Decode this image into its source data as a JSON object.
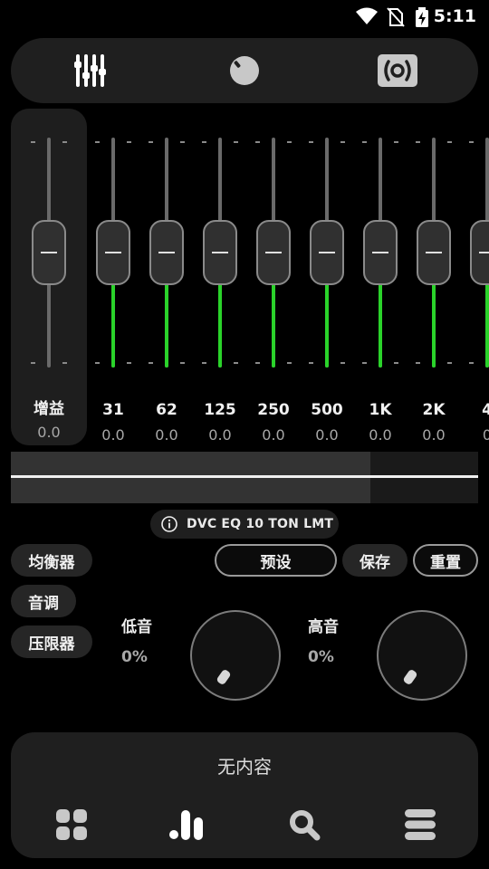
{
  "status_bar": {
    "time": "5:11"
  },
  "top_tabs": [
    {
      "icon": "equalizer-icon"
    },
    {
      "icon": "knob-icon"
    },
    {
      "icon": "speaker-icon"
    }
  ],
  "gain": {
    "label": "增益",
    "value": "0.0",
    "level": 0.5
  },
  "bands": [
    {
      "label": "31",
      "value": "0.0"
    },
    {
      "label": "62",
      "value": "0.0"
    },
    {
      "label": "125",
      "value": "0.0"
    },
    {
      "label": "250",
      "value": "0.0"
    },
    {
      "label": "500",
      "value": "0.0"
    },
    {
      "label": "1K",
      "value": "0.0"
    },
    {
      "label": "2K",
      "value": "0.0"
    },
    {
      "label": "4",
      "value": "0"
    }
  ],
  "meter": {
    "level": 0.77
  },
  "preset_info": {
    "icon": "info-icon",
    "text": "DVC EQ 10 TON LMT"
  },
  "side_buttons": {
    "equalizer": "均衡器",
    "tone": "音调",
    "limiter": "压限器"
  },
  "actions": {
    "preset": "预设",
    "save": "保存",
    "reset": "重置"
  },
  "bass": {
    "label": "低音",
    "value": "0%"
  },
  "treble": {
    "label": "高音",
    "value": "0%"
  },
  "bottom": {
    "empty_text": "无内容",
    "nav": [
      "grid-icon",
      "bars-icon",
      "search-icon",
      "menu-icon"
    ]
  },
  "colors": {
    "accent": "#2AD32A",
    "panel": "#1F1F1F",
    "background": "#000000"
  }
}
